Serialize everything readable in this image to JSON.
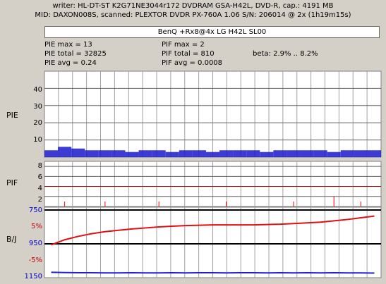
{
  "header": {
    "line1": "writer: HL-DT-ST K2G71NE3044r172 DVDRAM GSA-H42L, DVD-R, cap.: 4191 MB",
    "line2": "MID: DAXON008S, scanned: PLEXTOR DVDR PX-760A 1.06 S/N: 206014 @ 2x (1h19m15s)"
  },
  "disc_box": "BenQ +Rx8@4x LG H42L SL00",
  "stats": {
    "pie_max": "PIE max = 13",
    "pie_total": "PIE total = 32825",
    "pie_avg": "PIE avg = 0.24",
    "pif_max": "PIF max = 2",
    "pif_total": "PIF total = 810",
    "pif_avg": "PIF avg = 0.0008",
    "beta": "beta: 2.9% .. 8.2%"
  },
  "panels": {
    "pie_label": "PIE",
    "pif_label": "PIF",
    "bj_label": "B/J"
  },
  "axes": {
    "pie_ticks": [
      "40",
      "30",
      "20",
      "10"
    ],
    "pif_ticks": [
      "8",
      "6",
      "4",
      "2"
    ],
    "beta_ticks": [
      "750",
      "5%",
      "950",
      "-5%",
      "1150"
    ]
  },
  "colors": {
    "pie_series": "#1a1acc",
    "pif_series": "#ff0000",
    "beta_series": "#e01010",
    "jitter_series": "#2020d0",
    "tick_blue": "#0000c0",
    "tick_red": "#c00000"
  },
  "chart_data": [
    {
      "type": "area",
      "series": [
        {
          "values": [
            4,
            6,
            5,
            4,
            4,
            4,
            3,
            4,
            4,
            3,
            4,
            4,
            3,
            4,
            4,
            4,
            3,
            4,
            4,
            4,
            4,
            3,
            4,
            4,
            4
          ]
        }
      ],
      "ylim": [
        0,
        50
      ],
      "grid": true
    },
    {
      "type": "line",
      "series": [
        {
          "values": [
            0,
            1,
            0,
            0,
            1,
            0,
            0,
            0,
            1,
            0,
            0,
            0,
            0,
            1,
            0,
            0,
            0,
            0,
            1,
            0,
            0,
            2,
            0,
            1,
            0
          ]
        }
      ],
      "ylim": [
        0,
        9
      ],
      "grid": true
    },
    {
      "type": "line",
      "series": [
        {
          "values": [
            -0.3,
            1.2,
            2.2,
            3.0,
            3.6,
            4.0,
            4.4,
            4.7,
            5.0,
            5.2,
            5.4,
            5.5,
            5.6,
            5.6,
            5.6,
            5.6,
            5.7,
            5.8,
            6.0,
            6.2,
            6.4,
            6.8,
            7.2,
            7.7,
            8.2
          ]
        }
      ],
      "ylim": [
        -10,
        10
      ],
      "grid": true
    },
    {
      "type": "line",
      "series": [
        {
          "values": [
            1118,
            1120,
            1121,
            1121,
            1122,
            1122,
            1121,
            1122,
            1122,
            1121,
            1122,
            1121,
            1121,
            1122,
            1121,
            1121,
            1122,
            1121,
            1122,
            1121,
            1122,
            1121,
            1122,
            1122,
            1123
          ]
        }
      ],
      "ylim": [
        750,
        1150
      ],
      "grid": true
    }
  ]
}
